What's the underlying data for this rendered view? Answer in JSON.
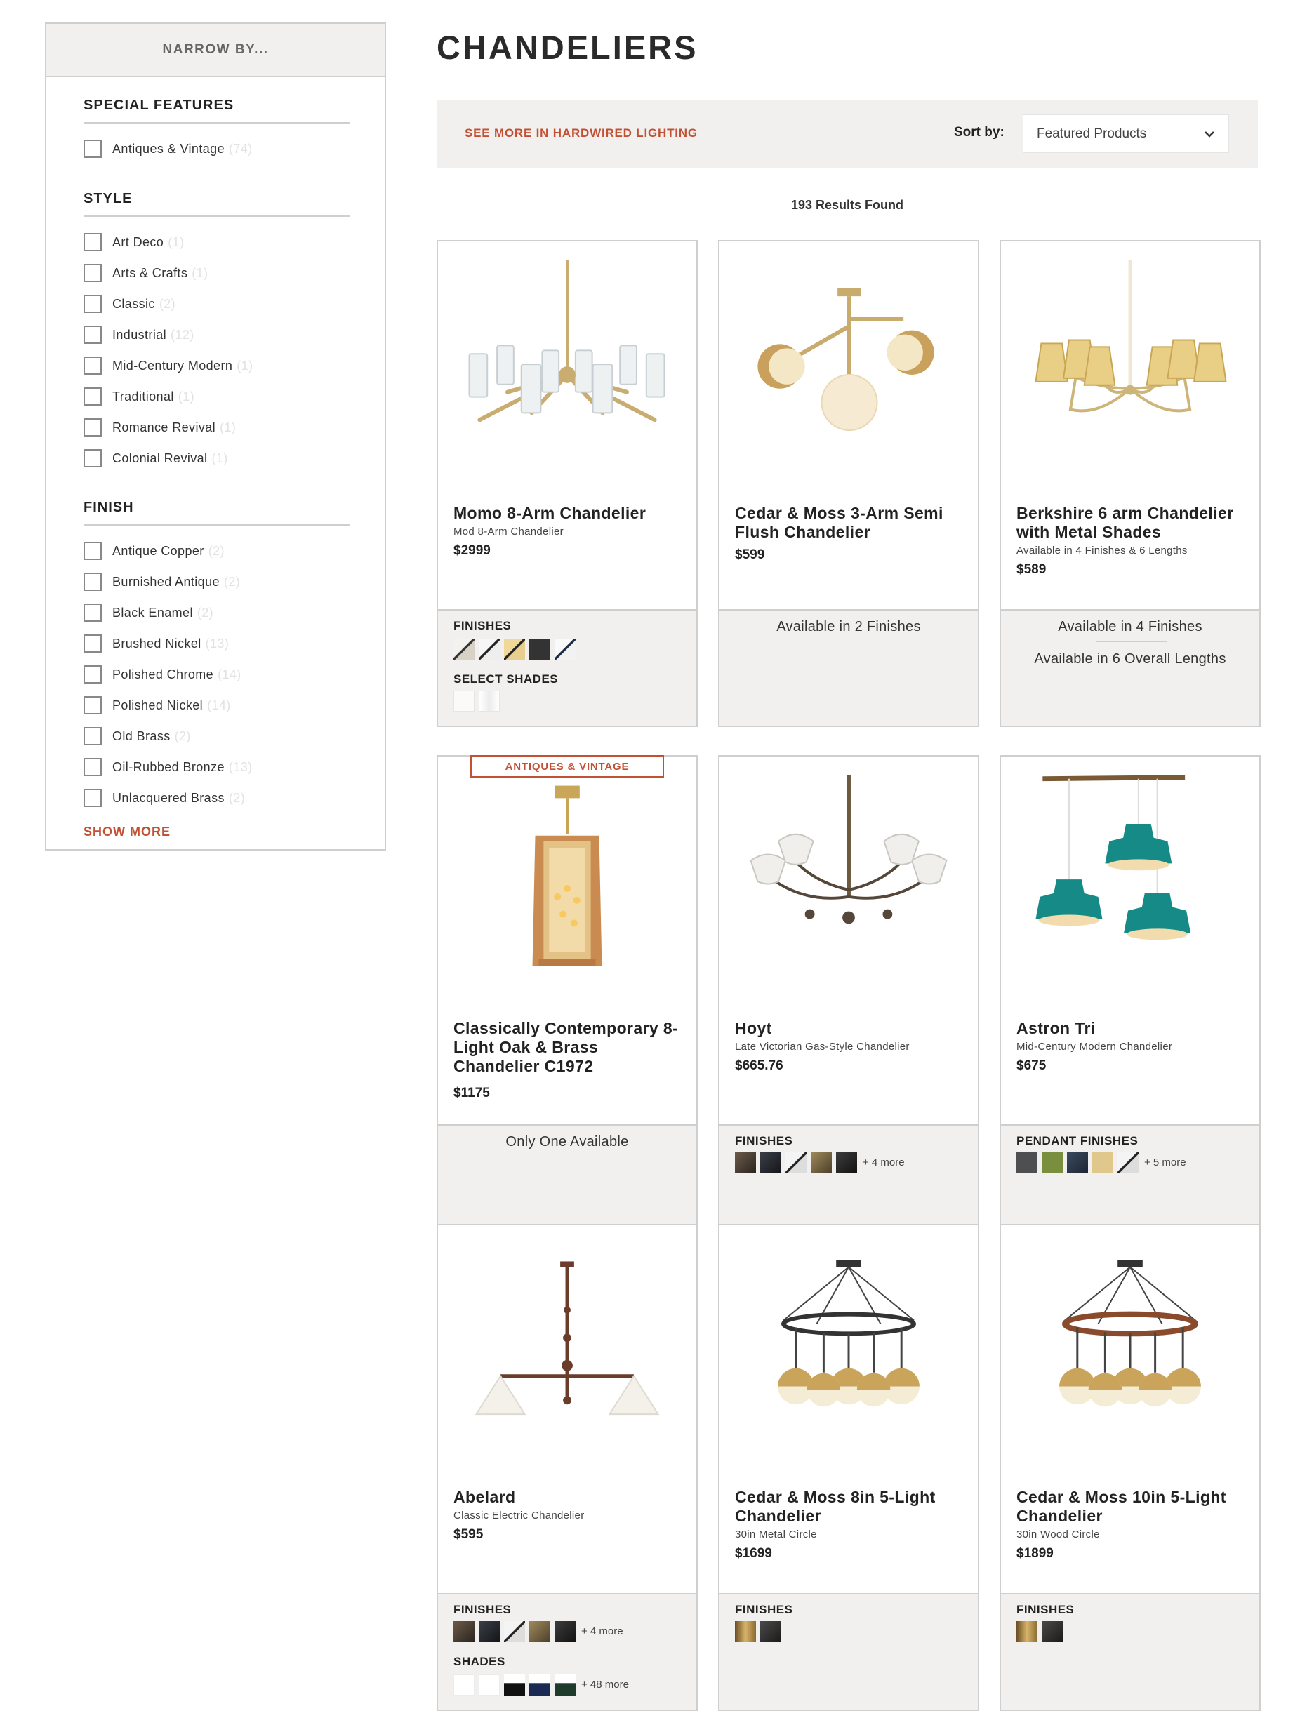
{
  "sidebar": {
    "header": "NARROW BY...",
    "sections": [
      {
        "title": "SPECIAL FEATURES",
        "options": [
          {
            "label": "Antiques & Vintage",
            "count": "(74)"
          }
        ]
      },
      {
        "title": "STYLE",
        "options": [
          {
            "label": "Art Deco",
            "count": "(1)"
          },
          {
            "label": "Arts & Crafts",
            "count": "(1)"
          },
          {
            "label": "Classic",
            "count": "(2)"
          },
          {
            "label": "Industrial",
            "count": "(12)"
          },
          {
            "label": "Mid-Century Modern",
            "count": "(1)"
          },
          {
            "label": "Traditional",
            "count": "(1)"
          },
          {
            "label": "Romance Revival",
            "count": "(1)"
          },
          {
            "label": "Colonial Revival",
            "count": "(1)"
          }
        ]
      },
      {
        "title": "FINISH",
        "options": [
          {
            "label": "Antique Copper",
            "count": "(2)"
          },
          {
            "label": "Burnished Antique",
            "count": "(2)"
          },
          {
            "label": "Black Enamel",
            "count": "(2)"
          },
          {
            "label": "Brushed Nickel",
            "count": "(13)"
          },
          {
            "label": "Polished Chrome",
            "count": "(14)"
          },
          {
            "label": "Polished Nickel",
            "count": "(14)"
          },
          {
            "label": "Old Brass",
            "count": "(2)"
          },
          {
            "label": "Oil-Rubbed Bronze",
            "count": "(13)"
          },
          {
            "label": "Unlacquered Brass",
            "count": "(2)"
          }
        ]
      }
    ],
    "show_more": "SHOW MORE"
  },
  "page_title": "CHANDELIERS",
  "toolbar": {
    "see_more": "SEE MORE IN HARDWIRED LIGHTING",
    "sort_label": "Sort by:",
    "sort_value": "Featured Products"
  },
  "results": "193 Results Found",
  "products": [
    {
      "name": "Momo 8-Arm Chandelier",
      "sub": "Mod 8-Arm Chandelier",
      "price": "$2999",
      "finish_label": "FINISHES",
      "shade_label": "SELECT SHADES"
    },
    {
      "name": "Cedar & Moss 3-Arm Semi Flush Chandelier",
      "sub": "",
      "price": "$599",
      "avail": "Available in 2 Finishes"
    },
    {
      "name": "Berkshire 6 arm Chandelier with Metal Shades",
      "sub": "Available in 4 Finishes & 6 Lengths",
      "price": "$589",
      "avail": "Available in 4 Finishes",
      "avail2": "Available in 6 Overall Lengths"
    },
    {
      "name": "Classically Contemporary 8-Light Oak & Brass Chandelier C1972",
      "sub": "",
      "price": "$1175",
      "badge": "ANTIQUES & VINTAGE",
      "avail": "Only One Available"
    },
    {
      "name": "Hoyt",
      "sub": "Late Victorian Gas-Style Chandelier",
      "price": "$665.76",
      "finish_label": "FINISHES",
      "more": "+ 4 more"
    },
    {
      "name": "Astron Tri",
      "sub": "Mid-Century Modern Chandelier",
      "price": "$675",
      "finish_label": "PENDANT FINISHES",
      "more": "+ 5 more"
    },
    {
      "name": "Abelard",
      "sub": "Classic Electric Chandelier",
      "price": "$595",
      "finish_label": "FINISHES",
      "more": "+ 4 more",
      "shade_label": "SHADES",
      "shade_more": "+ 48 more"
    },
    {
      "name": "Cedar & Moss 8in 5-Light Chandelier",
      "sub": "30in Metal Circle",
      "price": "$1699",
      "finish_label": "FINISHES"
    },
    {
      "name": "Cedar & Moss 10in 5-Light Chandelier",
      "sub": "30in Wood Circle",
      "price": "$1899",
      "finish_label": "FINISHES"
    }
  ],
  "colors": {
    "accent": "#c25134",
    "panel": "#f2f0ef",
    "border": "#cfcfcf",
    "brass": "#d2b777",
    "teal": "#168a86"
  }
}
